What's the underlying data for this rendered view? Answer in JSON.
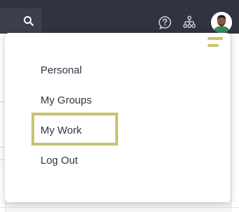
{
  "menu": {
    "items": [
      {
        "label": "Personal"
      },
      {
        "label": "My Groups"
      },
      {
        "label": "My Work"
      },
      {
        "label": "Log Out"
      }
    ],
    "highlighted_item": "My Work"
  },
  "icons": {
    "search": "search-icon",
    "help": "help-icon",
    "org": "org-chart-icon",
    "menu": "hamburger-menu-icon",
    "avatar": "user-avatar"
  },
  "colors": {
    "topbar": "#2f3440",
    "highlight": "#c7c36f",
    "menu_text": "#2e3440",
    "hamburger": "#c9c46d"
  }
}
